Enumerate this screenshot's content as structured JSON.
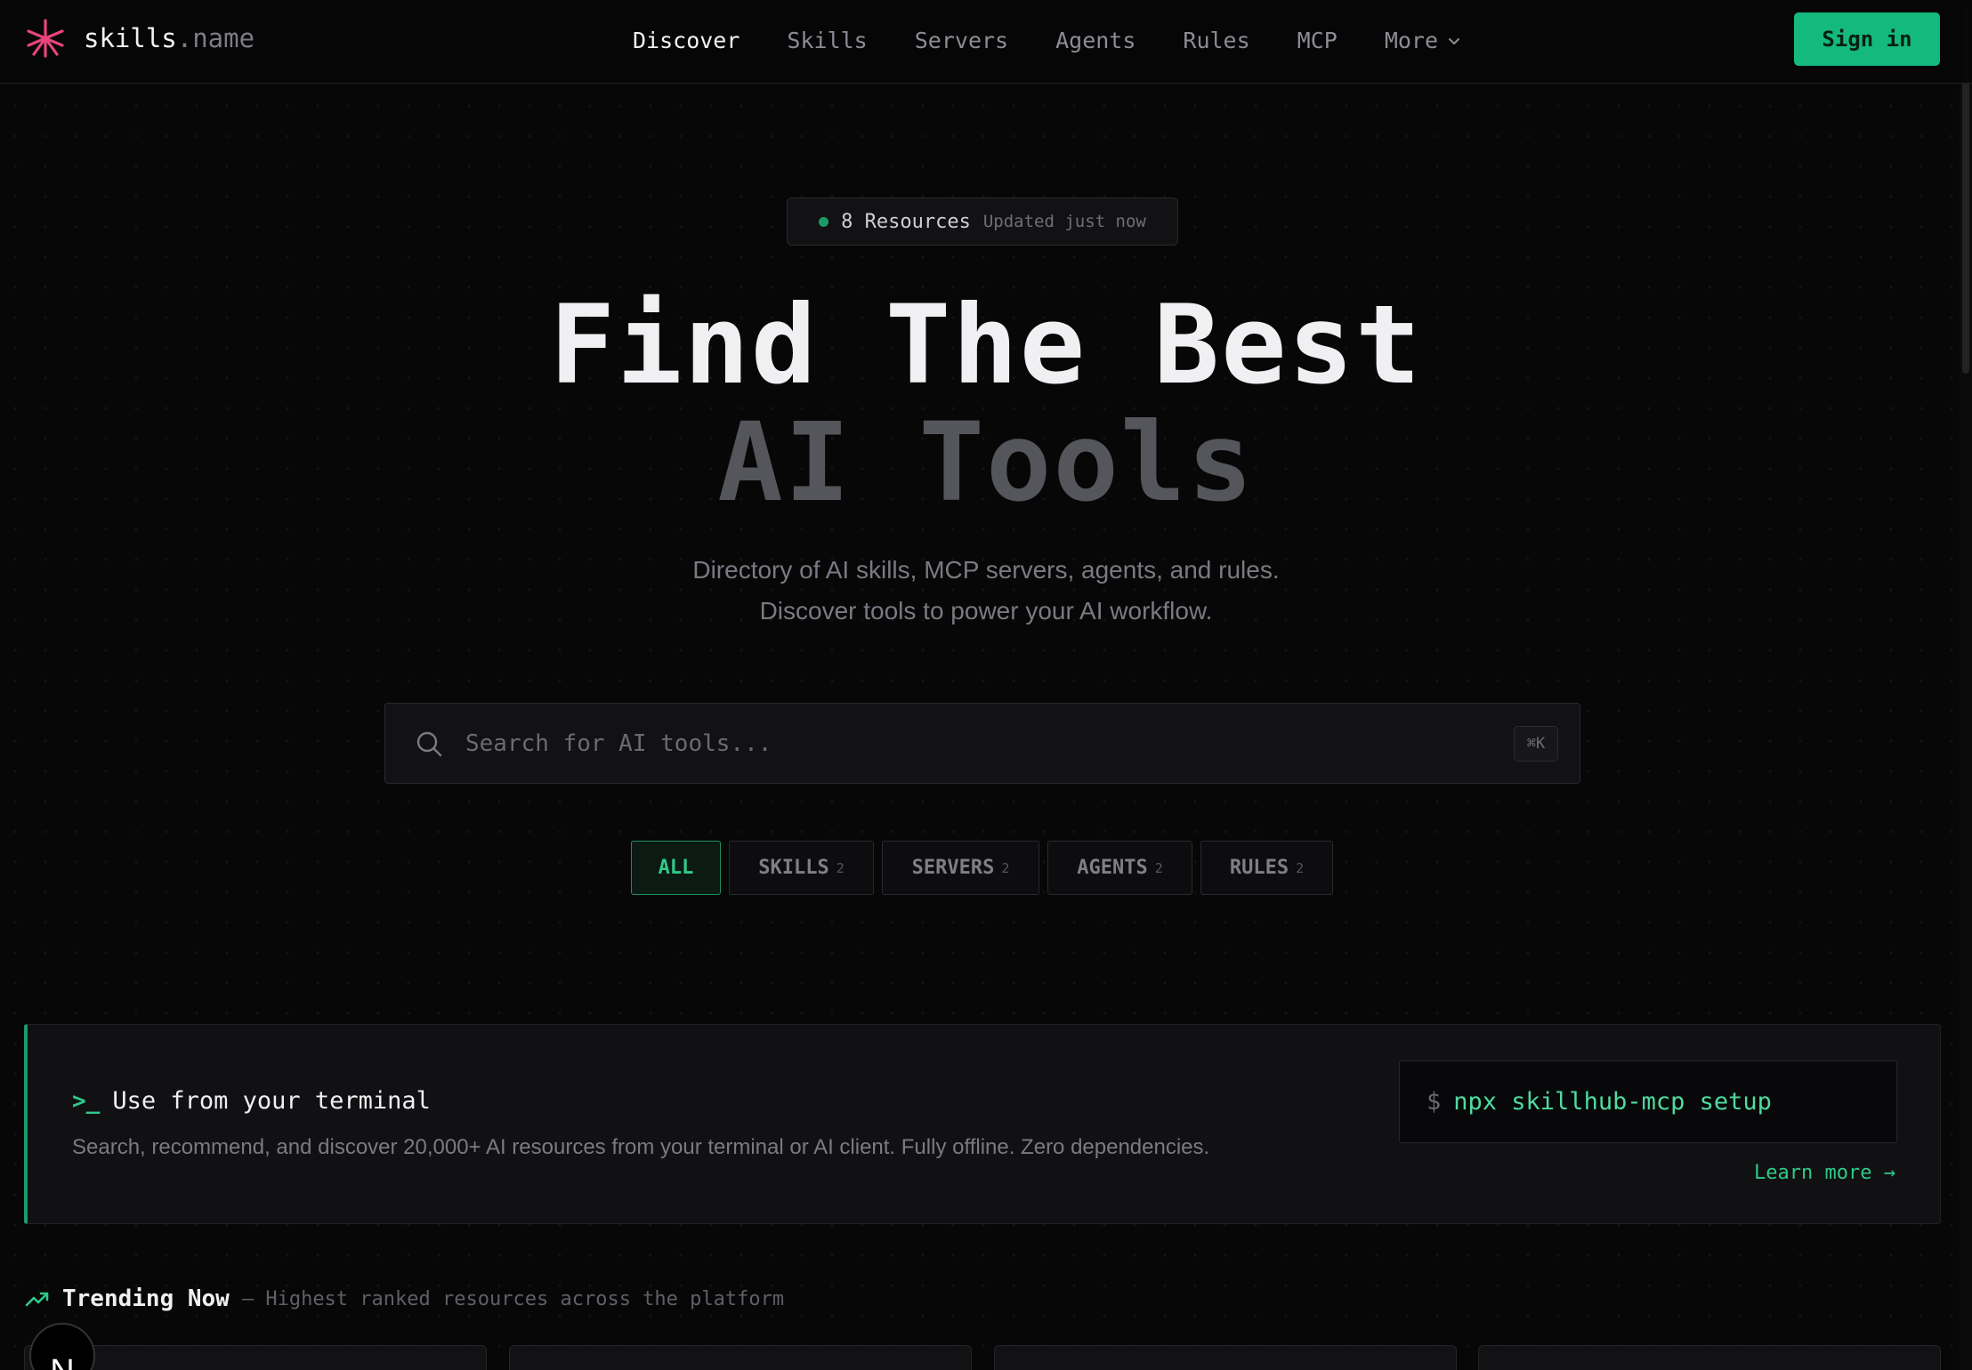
{
  "header": {
    "logo_main": "skills",
    "logo_tld": ".name",
    "nav": [
      {
        "label": "Discover",
        "active": true
      },
      {
        "label": "Skills"
      },
      {
        "label": "Servers"
      },
      {
        "label": "Agents"
      },
      {
        "label": "Rules"
      },
      {
        "label": "MCP"
      }
    ],
    "more_label": "More",
    "signin_label": "Sign in"
  },
  "hero": {
    "badge_count": "8 Resources",
    "badge_updated": "Updated just now",
    "title_line1": "Find The Best",
    "title_line2": "AI Tools",
    "subtitle_line1": "Directory of AI skills, MCP servers, agents, and rules.",
    "subtitle_line2": "Discover tools to power your AI workflow."
  },
  "search": {
    "placeholder": "Search for AI tools...",
    "value": "",
    "shortcut": "⌘K"
  },
  "filters": [
    {
      "label": "ALL",
      "count": "",
      "active": true
    },
    {
      "label": "SKILLS",
      "count": "2"
    },
    {
      "label": "SERVERS",
      "count": "2"
    },
    {
      "label": "AGENTS",
      "count": "2"
    },
    {
      "label": "RULES",
      "count": "2"
    }
  ],
  "terminal": {
    "prompt_icon": ">_",
    "title": "Use from your terminal",
    "description": "Search, recommend, and discover 20,000+ AI resources from your terminal or AI client. Fully offline. Zero dependencies.",
    "dollar": "$",
    "command": "npx skillhub-mcp setup",
    "learn_more": "Learn more →"
  },
  "trending": {
    "title": "Trending Now",
    "subtitle": "— Highest ranked resources across the platform"
  },
  "floating_badge": "N",
  "colors": {
    "accent": "#14b97d",
    "logo_star": "#e8457a",
    "background": "#070708"
  },
  "icons": {
    "logo": "asterisk-star-icon",
    "search": "search-icon",
    "more": "chevron-down-icon",
    "trending": "trending-up-icon"
  }
}
